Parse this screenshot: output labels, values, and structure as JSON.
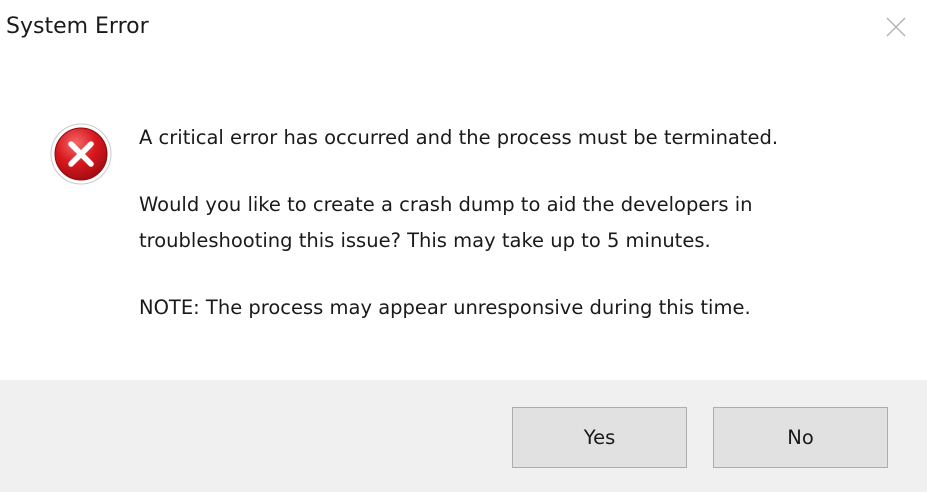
{
  "window": {
    "title": "System Error",
    "close_icon": "close-icon"
  },
  "icon": {
    "name": "error-icon",
    "color": "#d8181e"
  },
  "messages": {
    "line1": "A critical error has occurred and the process must be terminated.",
    "line2": "Would you like to create a crash dump to aid the developers in",
    "line3": "troubleshooting this issue? This may take up to 5 minutes.",
    "line4": "NOTE: The process may appear unresponsive during this time."
  },
  "buttons": {
    "yes_label": "Yes",
    "no_label": "No"
  },
  "colors": {
    "footer_background": "#f0f0f0",
    "button_background": "#e1e1e1",
    "button_border": "#adadad"
  }
}
